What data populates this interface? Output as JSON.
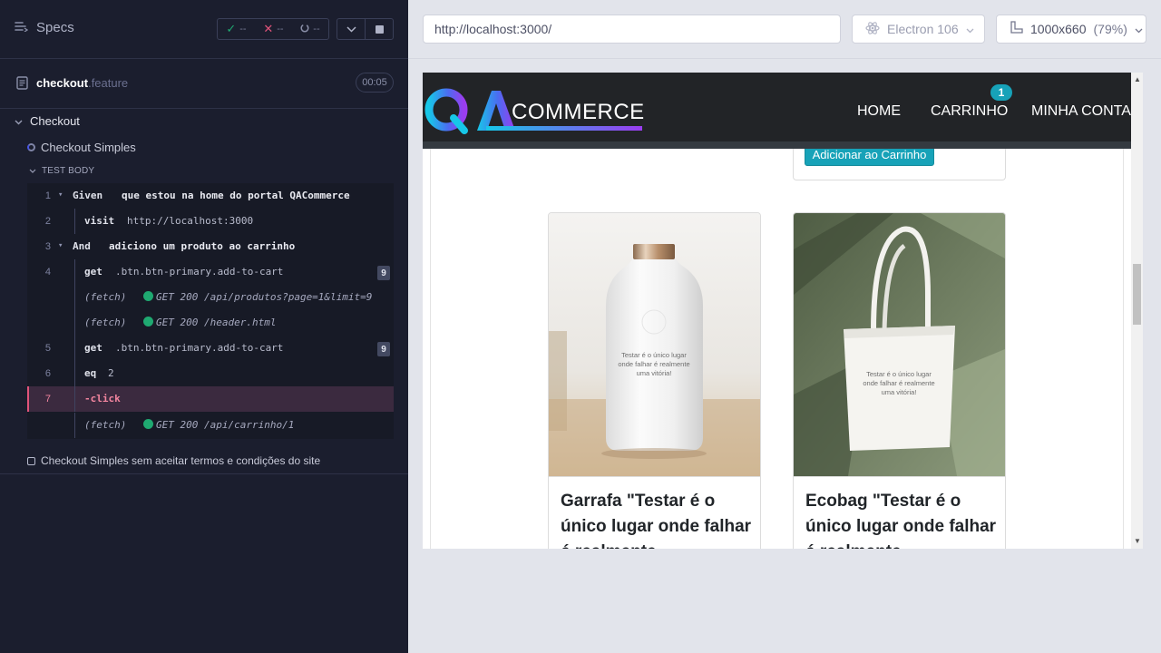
{
  "reporter": {
    "specs_label": "Specs",
    "stats": {
      "passed": "--",
      "failed": "--",
      "pending": "--"
    },
    "spec_file": {
      "name": "checkout",
      "ext": ".feature",
      "duration": "00:05"
    },
    "suite": "Checkout",
    "test": "Checkout Simples",
    "test_body_label": "TEST BODY",
    "commands": [
      {
        "num": "1",
        "name": "Given",
        "msg": "que estou na home do portal QACommerce"
      },
      {
        "num": "2",
        "name": "visit",
        "msg": "http://localhost:3000"
      },
      {
        "num": "3",
        "name": "And",
        "msg": "adiciono um produto ao carrinho"
      },
      {
        "num": "4",
        "name": "get",
        "msg": ".btn.btn-primary.add-to-cart",
        "count": "9"
      },
      {
        "num": "",
        "name": "(fetch)",
        "msg": "GET 200 /api/produtos?page=1&limit=9"
      },
      {
        "num": "",
        "name": "(fetch)",
        "msg": "GET 200 /header.html"
      },
      {
        "num": "5",
        "name": "get",
        "msg": ".btn.btn-primary.add-to-cart",
        "count": "9"
      },
      {
        "num": "6",
        "name": "eq",
        "msg": "2"
      },
      {
        "num": "7",
        "name": "-click",
        "msg": ""
      },
      {
        "num": "",
        "name": "(fetch)",
        "msg": "GET 200 /api/carrinho/1"
      }
    ],
    "pending_test": "Checkout Simples sem aceitar termos e condições do site"
  },
  "toolbar": {
    "url": "http://localhost:3000/",
    "browser": "Electron 106",
    "viewport": "1000x660",
    "scale": "(79%)"
  },
  "app": {
    "logo_text": "COMMERCE",
    "nav": {
      "home": "HOME",
      "cart": "CARRINHO",
      "account": "MINHA CONTA",
      "cart_count": "1"
    },
    "add_button": "Adicionar ao Carrinho",
    "products": [
      {
        "title": "Garrafa \"Testar é o único lugar onde falhar é realmente",
        "print": [
          "Testar é o único lugar",
          "onde falhar é realmente",
          "uma vitória!"
        ]
      },
      {
        "title": "Ecobag \"Testar é o único lugar onde falhar é realmente",
        "print": [
          "Testar é o único lugar",
          "onde falhar é realmente",
          "uma vitória!"
        ]
      }
    ]
  },
  "colors": {
    "panel": "#1b1e2e",
    "active": "#3b2a3f",
    "accent": "#17a2b8",
    "success": "#1fa971"
  }
}
